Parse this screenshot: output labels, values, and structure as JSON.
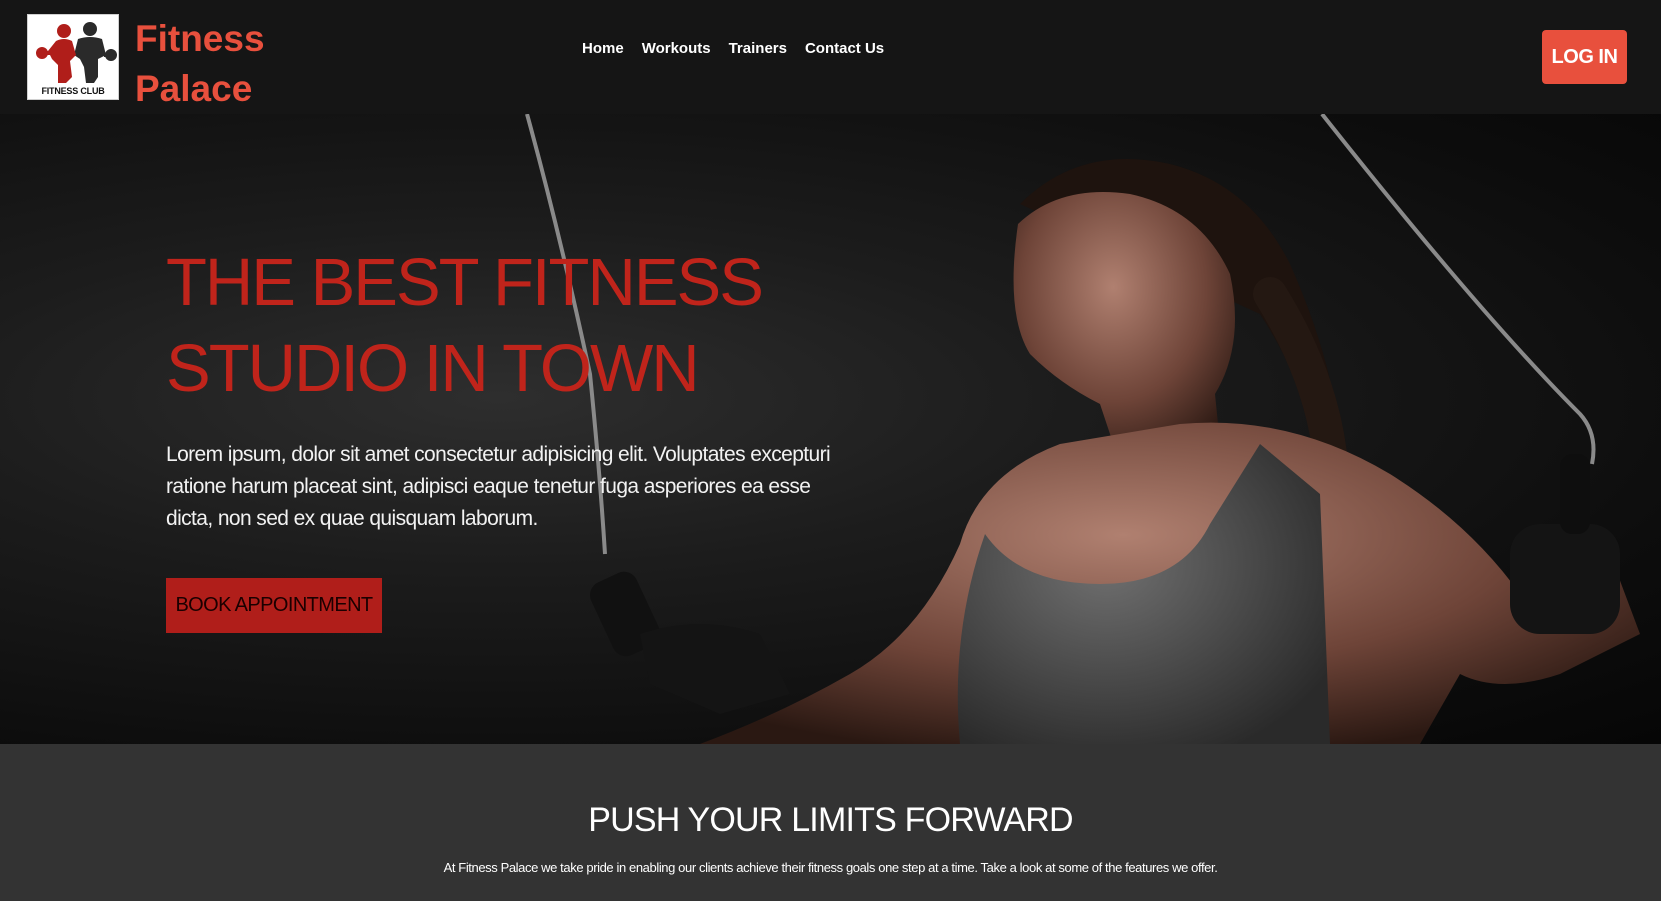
{
  "header": {
    "logo_caption": "FITNESS CLUB",
    "brand_line1": "Fitness",
    "brand_line2": "Palace",
    "nav": [
      "Home",
      "Workouts",
      "Trainers",
      "Contact Us"
    ],
    "login_label": "LOG IN"
  },
  "hero": {
    "title_line1": "THE BEST FITNESS",
    "title_line2": "STUDIO IN TOWN",
    "description": "Lorem ipsum, dolor sit amet consectetur adipisicing elit. Voluptates excepturi ratione harum placeat sint, adipisci eaque tenetur fuga asperiores ea esse dicta, non sed ex quae quisquam laborum.",
    "cta_label": "BOOK APPOINTMENT"
  },
  "features": {
    "title": "PUSH YOUR LIMITS FORWARD",
    "text": "At Fitness Palace we take pride in enabling our clients achieve their fitness goals one step at a time. Take a look at some of the features we offer."
  },
  "colors": {
    "brand": "#e8503d",
    "hero_title": "#c0241b",
    "cta": "#b01e1a",
    "navbar_bg": "#151515",
    "section_bg": "#333333"
  }
}
